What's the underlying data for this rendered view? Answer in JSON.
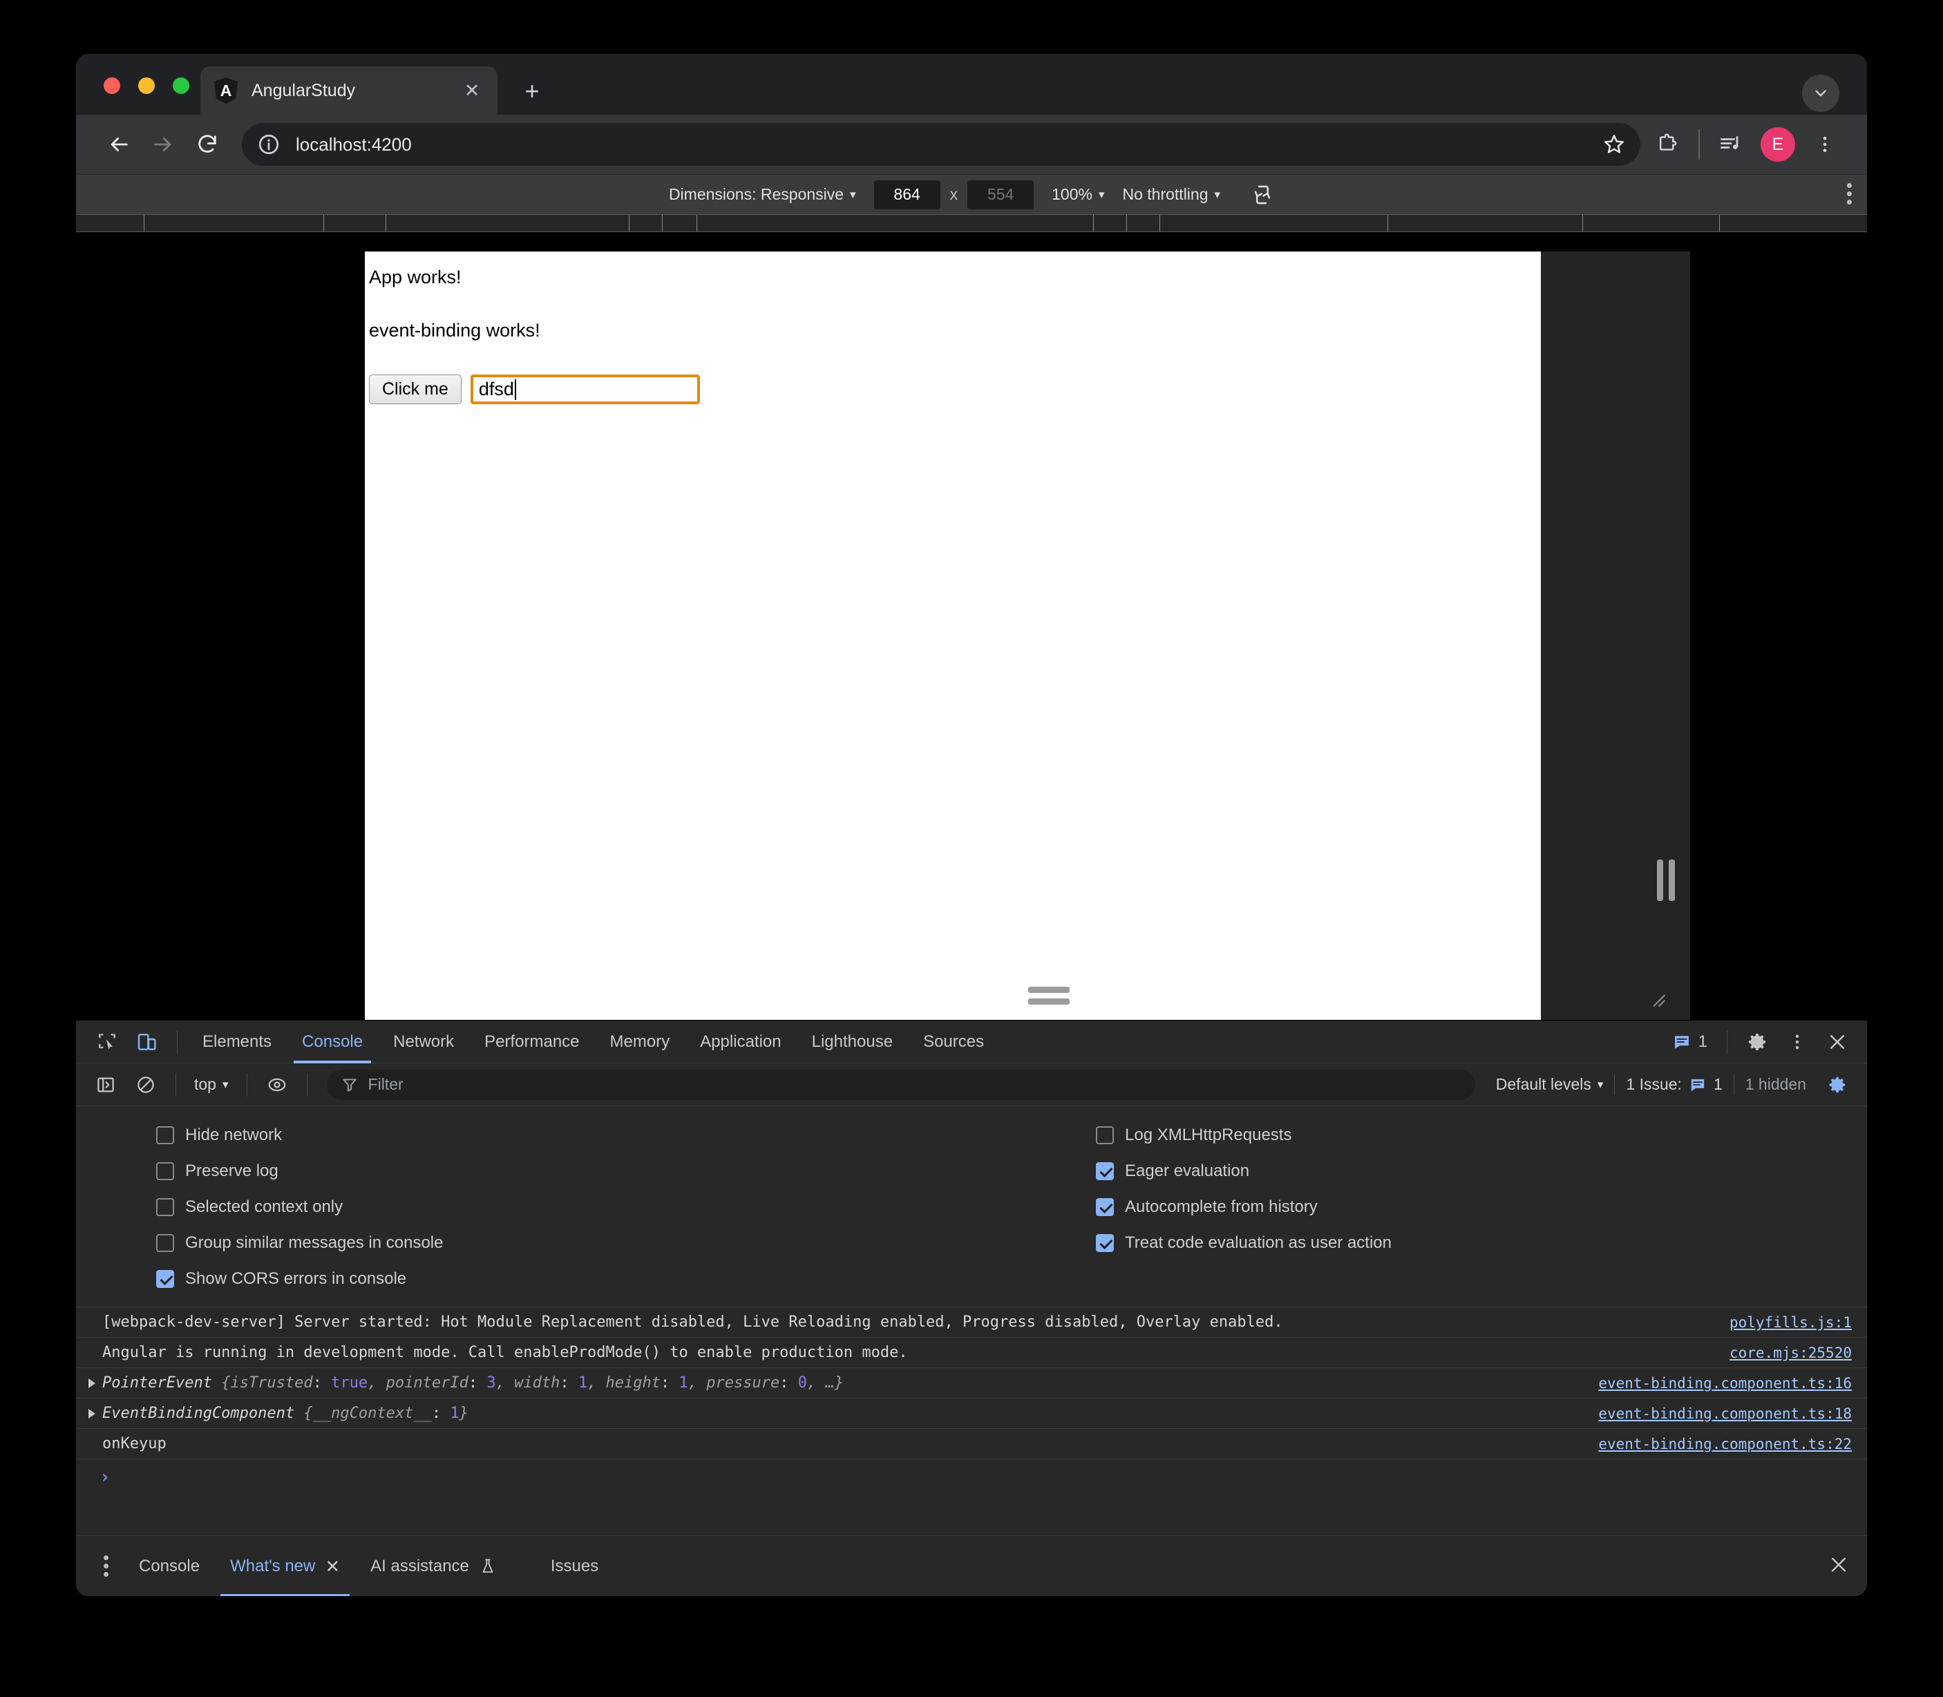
{
  "browser": {
    "tab": {
      "title": "AngularStudy",
      "favicon": "angular-logo-icon",
      "close": "✕"
    },
    "new_tab": "+",
    "omnibox": {
      "url": "localhost:4200",
      "site_info_icon": "info-circle-icon",
      "bookmark_icon": "star-icon"
    },
    "toolbar_icons": {
      "back": "back-arrow-icon",
      "forward": "forward-arrow-icon",
      "reload": "reload-icon",
      "extensions": "puzzle-piece-icon",
      "media": "media-list-icon",
      "profile_initial": "E",
      "menu": "kebab-menu-icon",
      "tabstrip_menu": "chevron-down-icon"
    }
  },
  "device_toolbar": {
    "dimensions_label": "Dimensions: Responsive",
    "width_value": "864",
    "height_placeholder": "554",
    "x_separator": "x",
    "zoom": "100%",
    "throttling": "No throttling",
    "rotate_icon": "rotate-device-icon",
    "more_options_icon": "kebab-menu-icon"
  },
  "page": {
    "heading_1": "App works!",
    "heading_2": "event-binding works!",
    "button_label": "Click me",
    "input_value": "dfsd"
  },
  "devtools": {
    "left_icons": {
      "inspect": "inspect-element-icon",
      "device_toggle": "device-toolbar-icon"
    },
    "tabs": [
      {
        "label": "Elements",
        "selected": false
      },
      {
        "label": "Console",
        "selected": true
      },
      {
        "label": "Network",
        "selected": false
      },
      {
        "label": "Performance",
        "selected": false
      },
      {
        "label": "Memory",
        "selected": false
      },
      {
        "label": "Application",
        "selected": false
      },
      {
        "label": "Lighthouse",
        "selected": false
      },
      {
        "label": "Sources",
        "selected": false
      }
    ],
    "header_right": {
      "issues_count": "1",
      "issues_icon": "issues-message-icon",
      "settings_icon": "gear-icon",
      "more_icon": "kebab-menu-icon",
      "close_icon": "close-icon"
    },
    "filter_bar": {
      "sidebar_icon": "console-sidebar-icon",
      "clear_icon": "clear-console-icon",
      "context": "top",
      "eye_icon": "live-expression-icon",
      "filter_icon": "filter-funnel-icon",
      "filter_placeholder": "Filter",
      "levels": "Default levels",
      "issues_text": "1 Issue:",
      "issues_badge_icon": "issues-message-icon",
      "issues_badge_count": "1",
      "hidden_text": "1 hidden",
      "settings_icon": "gear-icon"
    },
    "settings_left": [
      {
        "label": "Hide network",
        "checked": false
      },
      {
        "label": "Preserve log",
        "checked": false
      },
      {
        "label": "Selected context only",
        "checked": false
      },
      {
        "label": "Group similar messages in console",
        "checked": false
      },
      {
        "label": "Show CORS errors in console",
        "checked": true
      }
    ],
    "settings_right": [
      {
        "label": "Log XMLHttpRequests",
        "checked": false
      },
      {
        "label": "Eager evaluation",
        "checked": true
      },
      {
        "label": "Autocomplete from history",
        "checked": true
      },
      {
        "label": "Treat code evaluation as user action",
        "checked": true
      }
    ],
    "messages": [
      {
        "expandable": false,
        "text": "[webpack-dev-server] Server started: Hot Module Replacement disabled, Live Reloading enabled, Progress disabled, Overlay enabled.",
        "source": "polyfills.js:1"
      },
      {
        "expandable": false,
        "text": "Angular is running in development mode. Call enableProdMode() to enable production mode.",
        "source": "core.mjs:25520"
      },
      {
        "expandable": true,
        "object_name": "PointerEvent",
        "props": [
          {
            "key": "isTrusted",
            "value": "true",
            "type": "bool"
          },
          {
            "key": "pointerId",
            "value": "3",
            "type": "num"
          },
          {
            "key": "width",
            "value": "1",
            "type": "num"
          },
          {
            "key": "height",
            "value": "1",
            "type": "num"
          },
          {
            "key": "pressure",
            "value": "0",
            "type": "num"
          }
        ],
        "ellipsis": "…",
        "source": "event-binding.component.ts:16"
      },
      {
        "expandable": true,
        "object_name": "EventBindingComponent",
        "props": [
          {
            "key": "__ngContext__",
            "value": "1",
            "type": "num"
          }
        ],
        "ellipsis": "",
        "source": "event-binding.component.ts:18"
      },
      {
        "expandable": false,
        "text": "onKeyup",
        "source": "event-binding.component.ts:22"
      }
    ],
    "prompt_chevron": "›",
    "drawer": {
      "more_icon": "kebab-menu-icon",
      "tabs": [
        {
          "label": "Console",
          "selected": false,
          "closable": false,
          "experiment": false
        },
        {
          "label": "What's new",
          "selected": true,
          "closable": true,
          "experiment": false
        },
        {
          "label": "AI assistance",
          "selected": false,
          "closable": false,
          "experiment": true
        },
        {
          "label": "Issues",
          "selected": false,
          "closable": false,
          "experiment": false
        }
      ],
      "close_icon": "close-icon"
    }
  }
}
